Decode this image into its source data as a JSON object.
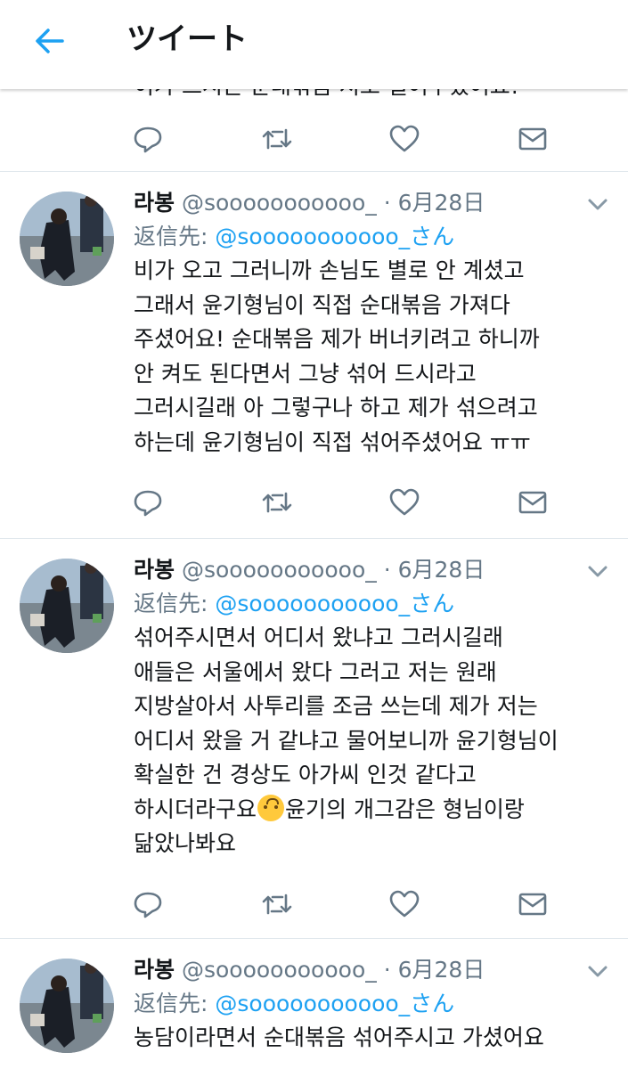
{
  "header": {
    "title": "ツイート"
  },
  "partial_tweet": {
    "text": "이가 드시는 순대볶음 저도 덜어주셨어요!"
  },
  "tweets": [
    {
      "name": "라봉",
      "handle": "@sooooooooooo_",
      "dot": "·",
      "date": "6月28日",
      "reply_label": "返信先:",
      "reply_handle": "@sooooooooooo_さん",
      "lines": [
        "비가 오고 그러니까 손님도 별로 안 계셨고",
        "그래서 윤기형님이 직접 순대볶음 가져다",
        "주셨어요! 순대볶음 제가 버너키려고 하니까",
        "안 켜도 된다면서 그냥 섞어 드시라고",
        "그러시길래 아 그렇구나 하고 제가 섞으려고",
        "하는데 윤기형님이 직접 섞어주셨어요 ㅠㅠ"
      ]
    },
    {
      "name": "라봉",
      "handle": "@sooooooooooo_",
      "dot": "·",
      "date": "6月28日",
      "reply_label": "返信先:",
      "reply_handle": "@sooooooooooo_さん",
      "lines": [
        "섞어주시면서 어디서 왔냐고 그러시길래",
        "애들은 서울에서 왔다 그러고 저는 원래",
        "지방살아서 사투리를 조금 쓰는데 제가 저는",
        "어디서 왔을 거 같냐고 물어보니까 윤기형님이",
        "확실한 건 경상도 아가씨 인것 같다고"
      ],
      "line_emoji_before": "하시더라구요",
      "line_emoji_after": "윤기의 개그감은 형님이랑",
      "emoji_icon": "upside-down-face-emoji",
      "last_line": "닮았나봐요"
    },
    {
      "name": "라봉",
      "handle": "@sooooooooooo_",
      "dot": "·",
      "date": "6月28日",
      "reply_label": "返信先:",
      "reply_handle": "@sooooooooooo_さん",
      "lines": [
        "농담이라면서 순대볶음 섞어주시고 가셨어요"
      ]
    }
  ],
  "icons": {
    "back": "arrow-left-icon",
    "reply": "reply-icon",
    "retweet": "retweet-icon",
    "like": "heart-icon",
    "dm": "envelope-icon",
    "menu": "chevron-down-icon"
  },
  "colors": {
    "accent": "#1da1f2",
    "secondary_text": "#657786",
    "divider": "#e1e8ed"
  }
}
